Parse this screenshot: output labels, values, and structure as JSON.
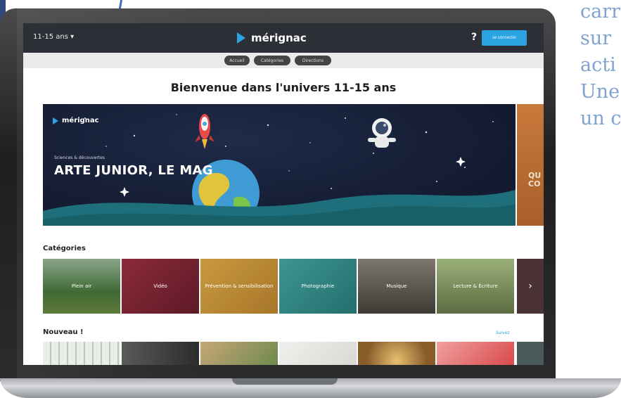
{
  "background_caption": {
    "lines": [
      "carr",
      "sur",
      "acti",
      "Une",
      "un c"
    ]
  },
  "site": {
    "age_selector": "11-15 ans",
    "logo_text": "mérignac",
    "help_icon": "?",
    "login_label": "se connecter",
    "nav": [
      "Accueil",
      "Catégories",
      "Directions"
    ],
    "welcome": "Bienvenue dans l'univers 11-15 ans"
  },
  "hero": {
    "logo_text": "mérignac",
    "kicker": "Sciences & découvertes",
    "title": "ARTE JUNIOR, LE MAG",
    "next_slide_text": "QU\nCO"
  },
  "categories": {
    "title": "Catégories",
    "items": [
      {
        "label": "Plein air",
        "color": "#4c6b3e"
      },
      {
        "label": "Vidéo",
        "color": "#8b2a3a"
      },
      {
        "label": "Prévention & sensibilisation",
        "color": "#b8862e"
      },
      {
        "label": "Photographie",
        "color": "#2f7e7c"
      },
      {
        "label": "Musique",
        "color": "#5a5a58"
      },
      {
        "label": "Lecture & Écriture",
        "color": "#6f8a5a"
      }
    ],
    "more_icon": "chevron-right-icon"
  },
  "new_section": {
    "title": "Nouveau !",
    "see_all": "Suivez"
  },
  "colors": {
    "topbar": "#2c2f36",
    "accent": "#2aa3e0",
    "hero_bg": "#141b31"
  }
}
